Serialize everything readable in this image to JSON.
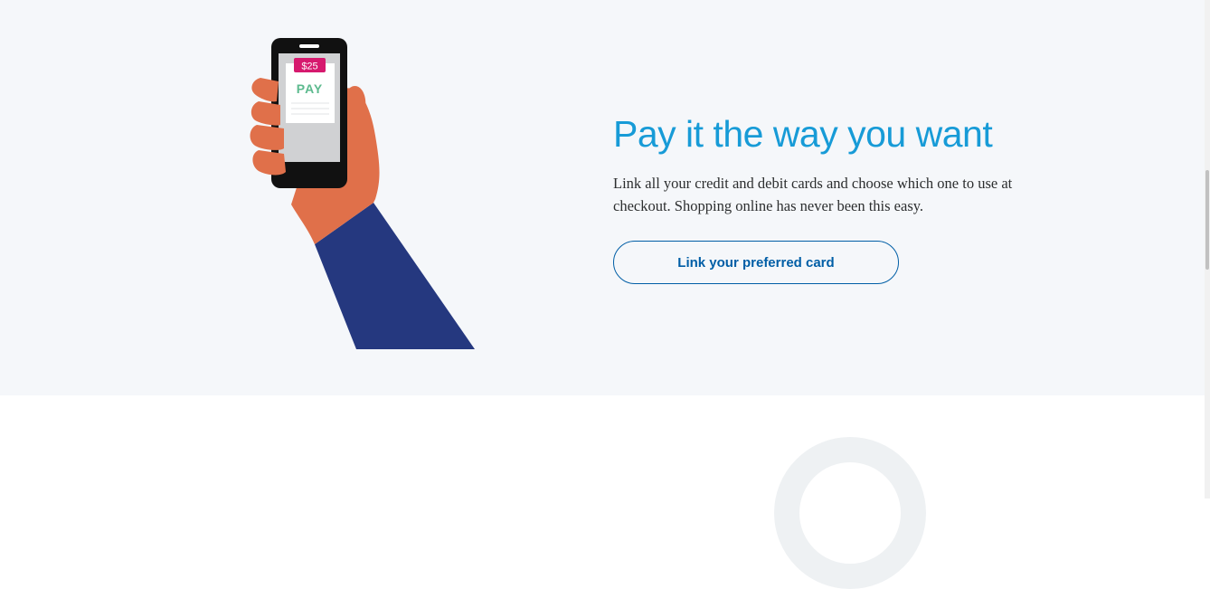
{
  "hero": {
    "phone_price": "$25",
    "phone_pay_label": "PAY",
    "headline": "Pay it the way you want",
    "body": "Link all your credit and debit cards and choose which one to use at checkout. Shopping online has never been this easy.",
    "cta_label": "Link your preferred card"
  },
  "icons": {
    "hand_phone": "hand-holding-phone-illustration",
    "ring": "ring-illustration"
  },
  "colors": {
    "headline": "#179bd7",
    "cta": "#005ea6",
    "hero_bg": "#f5f7fa",
    "sleeve": "#25387f",
    "skin": "#e0704a",
    "price_tag": "#d6196e",
    "pay_text": "#5cba8e"
  }
}
